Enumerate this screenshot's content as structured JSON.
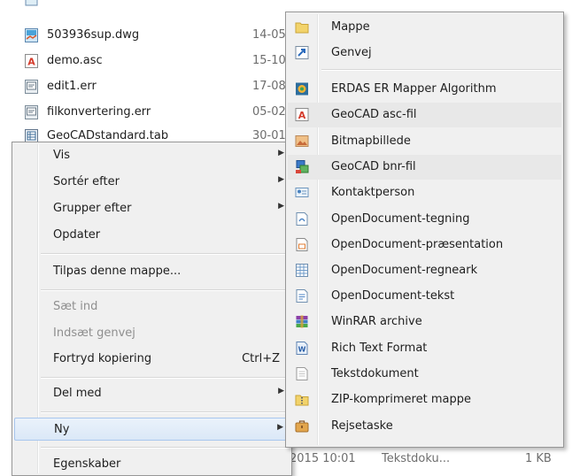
{
  "files": [
    {
      "name": "503936sup.dwg",
      "date": "14-05",
      "icon": "dwg-file-icon"
    },
    {
      "name": "demo.asc",
      "date": "15-10",
      "icon": "asc-file-icon"
    },
    {
      "name": "edit1.err",
      "date": "17-08",
      "icon": "err-file-icon"
    },
    {
      "name": "filkonvertering.err",
      "date": "05-02",
      "icon": "err-file-icon"
    },
    {
      "name": "GeoCADstandard.tab",
      "date": "30-01",
      "icon": "tab-file-icon"
    }
  ],
  "bottom_row": {
    "date": "2015 10:01",
    "type": "Tekstdoku...",
    "size": "1 KB"
  },
  "context_menu": {
    "vis": "Vis",
    "sorter": "Sortér efter",
    "grupper": "Grupper efter",
    "opdater": "Opdater",
    "tilpas": "Tilpas denne mappe...",
    "saet_ind": "Sæt ind",
    "indsaet_genvej": "Indsæt genvej",
    "fortryd": "Fortryd kopiering",
    "fortryd_shortcut": "Ctrl+Z",
    "del_med": "Del med",
    "ny": "Ny",
    "egenskaber": "Egenskaber"
  },
  "submenu": {
    "items": [
      {
        "label": "Mappe",
        "icon": "folder-icon"
      },
      {
        "label": "Genvej",
        "icon": "shortcut-icon"
      },
      {
        "label": "ERDAS ER Mapper Algorithm",
        "icon": "erdas-icon"
      },
      {
        "label": "GeoCAD asc-fil",
        "icon": "geocad-asc-icon"
      },
      {
        "label": "Bitmapbillede",
        "icon": "bitmap-icon"
      },
      {
        "label": "GeoCAD bnr-fil",
        "icon": "geocad-bnr-icon"
      },
      {
        "label": "Kontaktperson",
        "icon": "contact-icon"
      },
      {
        "label": "OpenDocument-tegning",
        "icon": "odg-icon"
      },
      {
        "label": "OpenDocument-præsentation",
        "icon": "odp-icon"
      },
      {
        "label": "OpenDocument-regneark",
        "icon": "ods-icon"
      },
      {
        "label": "OpenDocument-tekst",
        "icon": "odt-icon"
      },
      {
        "label": "WinRAR archive",
        "icon": "winrar-icon"
      },
      {
        "label": "Rich Text Format",
        "icon": "rtf-icon"
      },
      {
        "label": "Tekstdokument",
        "icon": "text-document-icon"
      },
      {
        "label": "ZIP-komprimeret mappe",
        "icon": "zip-folder-icon"
      },
      {
        "label": "Rejsetaske",
        "icon": "briefcase-icon"
      }
    ]
  },
  "colors": {
    "highlight_border": "#a8c6ee",
    "menu_bg": "#f0f0f0"
  }
}
